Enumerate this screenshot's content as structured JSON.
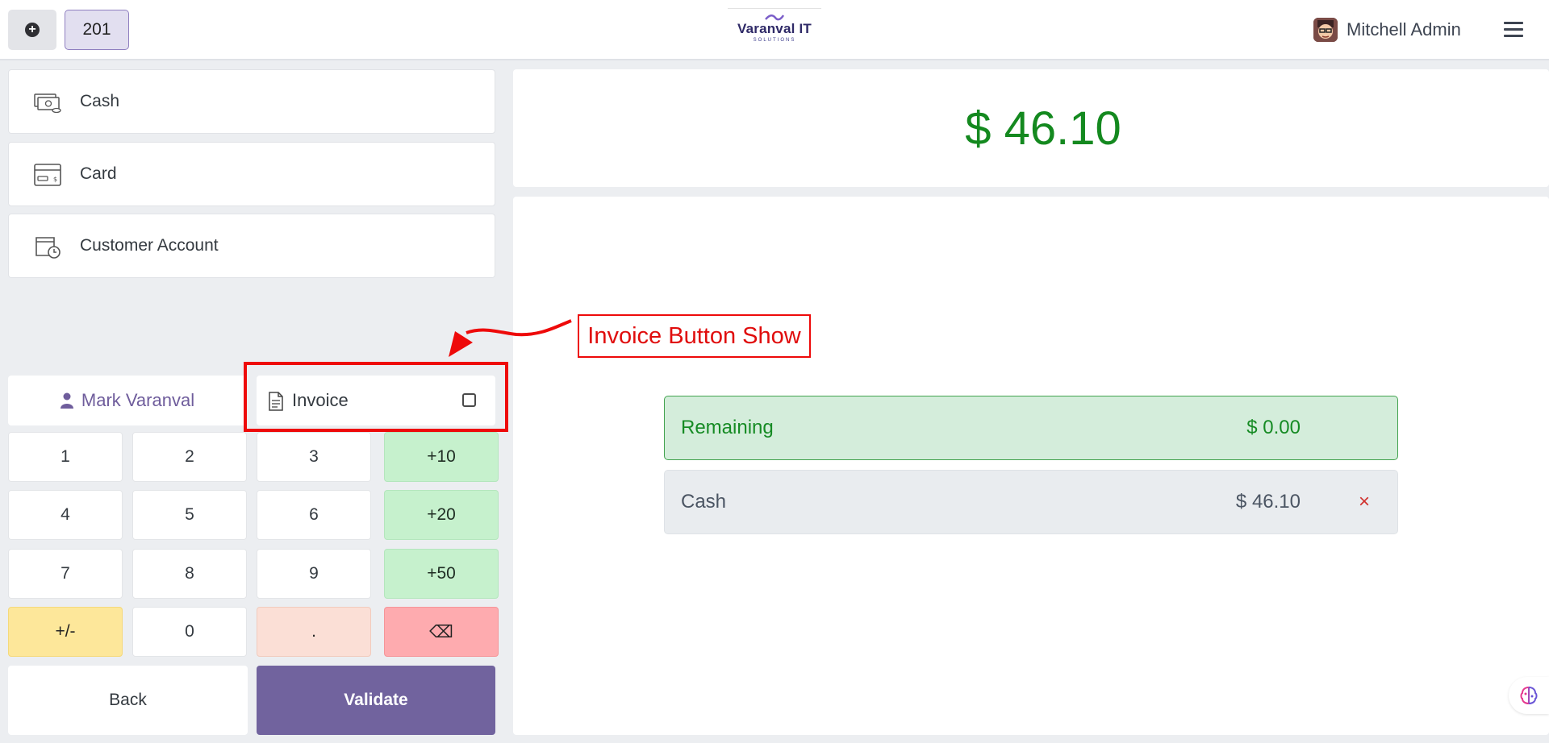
{
  "header": {
    "order_number": "201",
    "logo": {
      "name": "Varanval IT",
      "sub": "SOLUTIONS"
    },
    "user_name": "Mitchell Admin"
  },
  "payment_methods": [
    {
      "label": "Cash",
      "icon": "cash-icon"
    },
    {
      "label": "Card",
      "icon": "card-icon"
    },
    {
      "label": "Customer Account",
      "icon": "wallet-clock-icon"
    }
  ],
  "customer": {
    "name": "Mark Varanval"
  },
  "invoice": {
    "label": "Invoice",
    "checked": false
  },
  "numpad": {
    "keys": [
      "1",
      "2",
      "3",
      "+10",
      "4",
      "5",
      "6",
      "+20",
      "7",
      "8",
      "9",
      "+50",
      "+/-",
      "0",
      ".",
      "⌫"
    ]
  },
  "actions": {
    "back": "Back",
    "validate": "Validate"
  },
  "summary": {
    "total": "$ 46.10",
    "remaining_label": "Remaining",
    "remaining_amount": "$ 0.00",
    "cash_label": "Cash",
    "cash_amount": "$ 46.10",
    "delete_symbol": "×"
  },
  "annotation": {
    "text": "Invoice Button Show",
    "color": "#ee0a0a"
  },
  "colors": {
    "accent": "#71639e",
    "positive": "#14891f",
    "numpad_green": "#c6f1cd",
    "numpad_yellow": "#fde79a",
    "numpad_peach": "#fbdfd6",
    "numpad_red": "#feabaf"
  }
}
